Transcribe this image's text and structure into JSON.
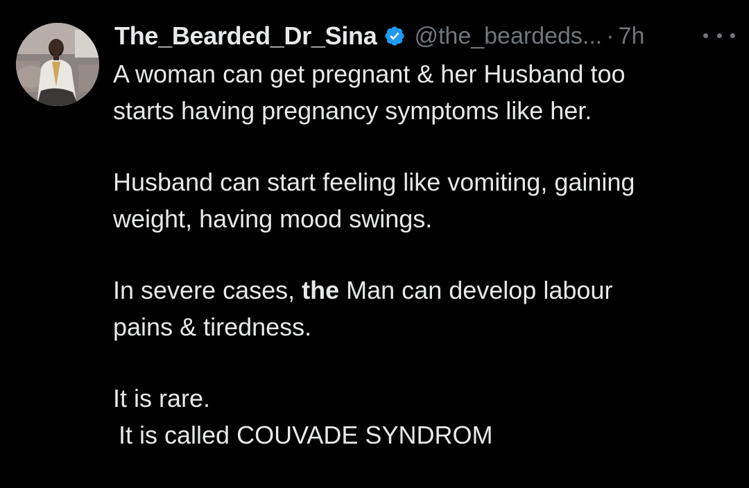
{
  "tweet": {
    "author": {
      "display_name": "The_Bearded_Dr_Sina",
      "handle": "@the_beardeds...",
      "verified_icon": "verified-badge-icon",
      "avatar": "profile-photo"
    },
    "separator": "·",
    "time": "7h",
    "more_icon": "more-options-icon",
    "body": {
      "p1_line1": "A woman can get pregnant & her Husband too",
      "p1_line2": "starts having pregnancy symptoms like her.",
      "p2_line1": "Husband can start feeling like vomiting, gaining",
      "p2_line2": "weight, having mood swings.",
      "p3_line1_a": "In severe cases, ",
      "p3_line1_bold": "the",
      "p3_line1_b": " Man can develop labour",
      "p3_line2": "pains & tiredness.",
      "p4_line1": "It is rare.",
      "p4_line2": "It is called COUVADE SYNDROM"
    }
  },
  "colors": {
    "background": "#000000",
    "text_primary": "#e7e9ea",
    "text_secondary": "#71767b",
    "verified_blue": "#1d9bf0"
  }
}
